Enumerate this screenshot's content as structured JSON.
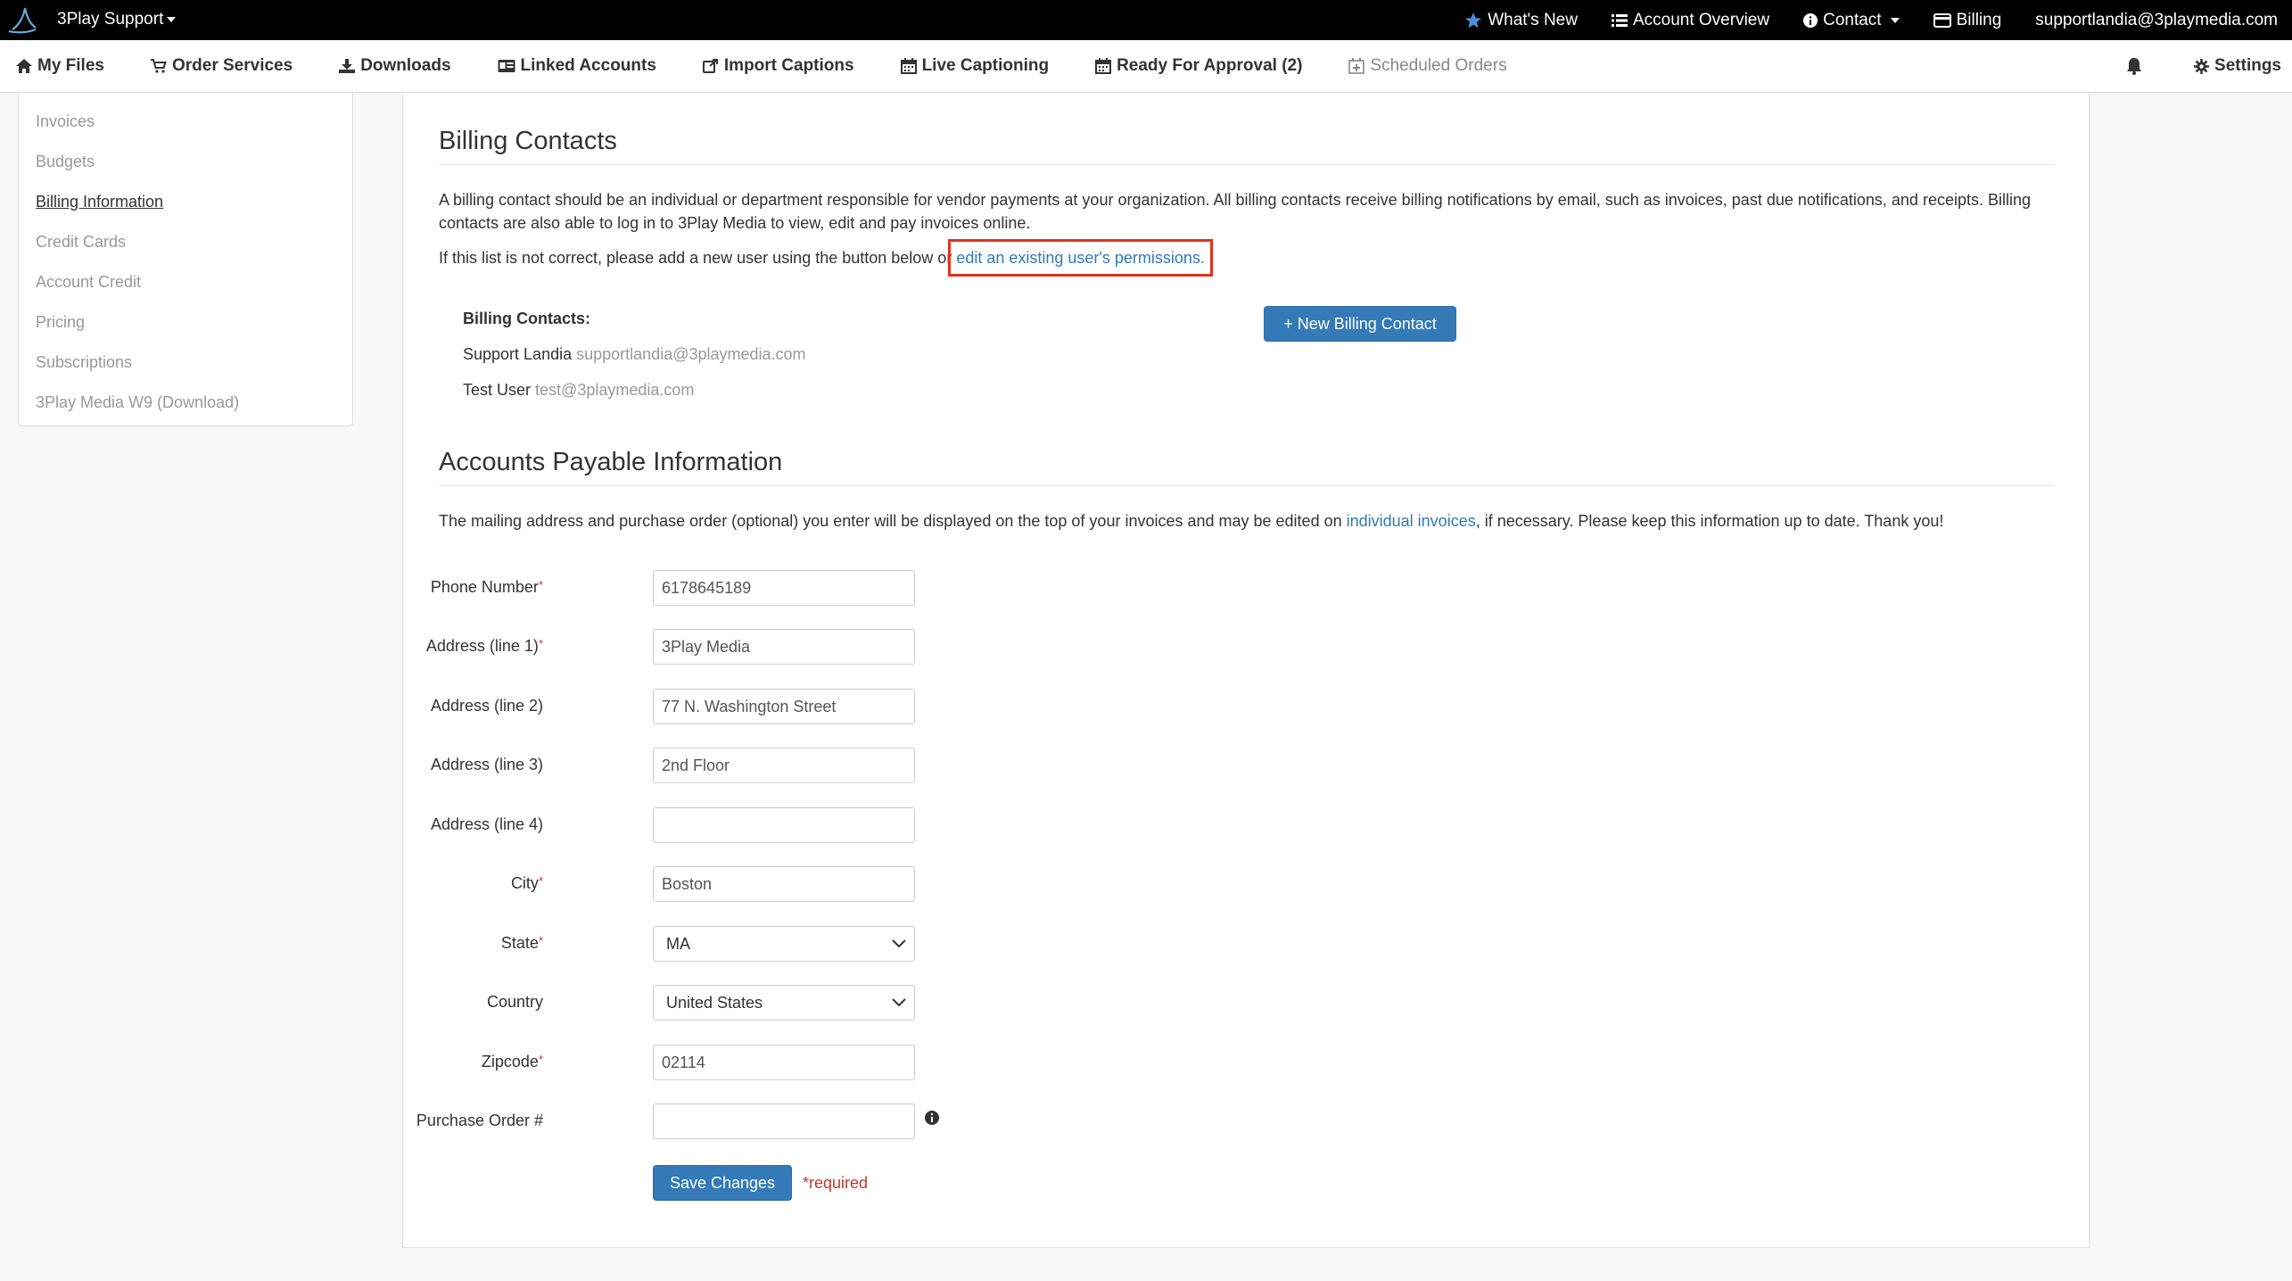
{
  "topbar": {
    "brand": "3Play Support",
    "items": [
      {
        "label": "What's New",
        "icon": "star-icon"
      },
      {
        "label": "Account Overview",
        "icon": "list-icon"
      },
      {
        "label": "Contact",
        "icon": "info-icon"
      },
      {
        "label": "Billing",
        "icon": "credit-card-icon"
      },
      {
        "label": "supportlandia@3playmedia.com"
      }
    ]
  },
  "nav": {
    "items": [
      {
        "label": "My Files",
        "icon": "home-icon"
      },
      {
        "label": "Order Services",
        "icon": "cart-icon"
      },
      {
        "label": "Downloads",
        "icon": "download-icon"
      },
      {
        "label": "Linked Accounts",
        "icon": "id-card-icon"
      },
      {
        "label": "Import Captions",
        "icon": "external-link-icon"
      },
      {
        "label": "Live Captioning",
        "icon": "calendar-icon"
      },
      {
        "label": "Ready For Approval (2)",
        "icon": "calendar-icon"
      },
      {
        "label": "Scheduled Orders",
        "icon": "calendar-plus-icon"
      }
    ],
    "settings": "Settings"
  },
  "sidebar": {
    "items": [
      {
        "label": "Invoices"
      },
      {
        "label": "Budgets"
      },
      {
        "label": "Billing Information",
        "active": true
      },
      {
        "label": "Credit Cards"
      },
      {
        "label": "Account Credit"
      },
      {
        "label": "Pricing"
      },
      {
        "label": "Subscriptions"
      },
      {
        "label": "3Play Media W9 (Download)"
      }
    ]
  },
  "billing": {
    "title": "Billing Contacts",
    "para1": "A billing contact should be an individual or department responsible for vendor payments at your organization. All billing contacts receive billing notifications by email, such as invoices, past due notifications, and receipts. Billing contacts are also able to log in to 3Play Media to view, edit and pay invoices online.",
    "para2_prefix": "If this list is not correct, please add a new user using the button below or",
    "para2_link": "edit an existing user's permissions.",
    "contacts_label": "Billing Contacts:",
    "contacts": [
      {
        "name": "Support Landia",
        "email": "supportlandia@3playmedia.com"
      },
      {
        "name": "Test User",
        "email": "test@3playmedia.com"
      }
    ],
    "new_button": "+ New Billing Contact"
  },
  "payable": {
    "title": "Accounts Payable Information",
    "para_prefix": "The mailing address and purchase order (optional) you enter will be displayed on the top of your invoices and may be edited on",
    "para_link": "individual invoices",
    "para_suffix": ", if necessary. Please keep this information up to date. Thank you!",
    "fields": {
      "phone": {
        "label": "Phone Number",
        "value": "6178645189"
      },
      "addr1": {
        "label": "Address (line 1)",
        "value": "3Play Media"
      },
      "addr2": {
        "label": "Address (line 2)",
        "value": "77 N. Washington Street"
      },
      "addr3": {
        "label": "Address (line 3)",
        "value": "2nd Floor"
      },
      "addr4": {
        "label": "Address (line 4)",
        "value": ""
      },
      "city": {
        "label": "City",
        "value": "Boston"
      },
      "state": {
        "label": "State",
        "value": "MA"
      },
      "country": {
        "label": "Country",
        "value": "United States"
      },
      "zip": {
        "label": "Zipcode",
        "value": "02114"
      },
      "po": {
        "label": "Purchase Order #",
        "value": ""
      }
    },
    "required_mark": "*",
    "save_button": "Save Changes",
    "required_note": "*required"
  }
}
